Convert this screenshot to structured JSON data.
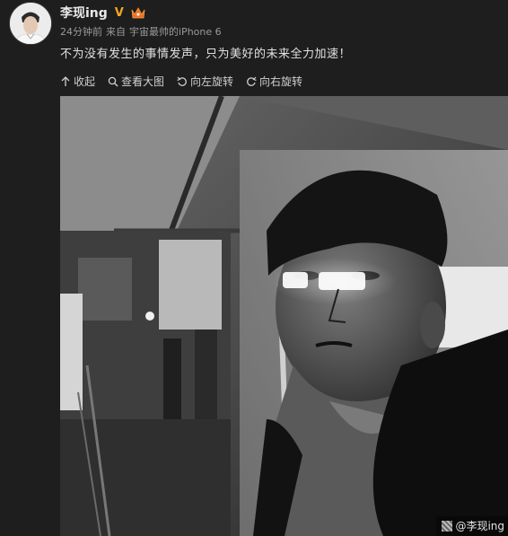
{
  "post": {
    "username": "李现ing",
    "verified_badge": "V",
    "time": "24分钟前",
    "source_prefix": "来自",
    "source": "宇宙最帅的iPhone 6",
    "text": "不为没有发生的事情发声，只为美好的未来全力加速！"
  },
  "toolbar": {
    "collapse": "收起",
    "view_large": "查看大图",
    "rotate_left": "向左旋转",
    "rotate_right": "向右旋转"
  },
  "photo": {
    "watermark": "@李现ing"
  },
  "icons": {
    "collapse": "arrow-up-icon",
    "view_large": "magnifier-icon",
    "rotate_left": "rotate-left-icon",
    "rotate_right": "rotate-right-icon"
  },
  "colors": {
    "background": "#1e1e1e",
    "verified": "#f5a623",
    "text": "#e0e0e0",
    "meta": "#9a9a9a"
  }
}
